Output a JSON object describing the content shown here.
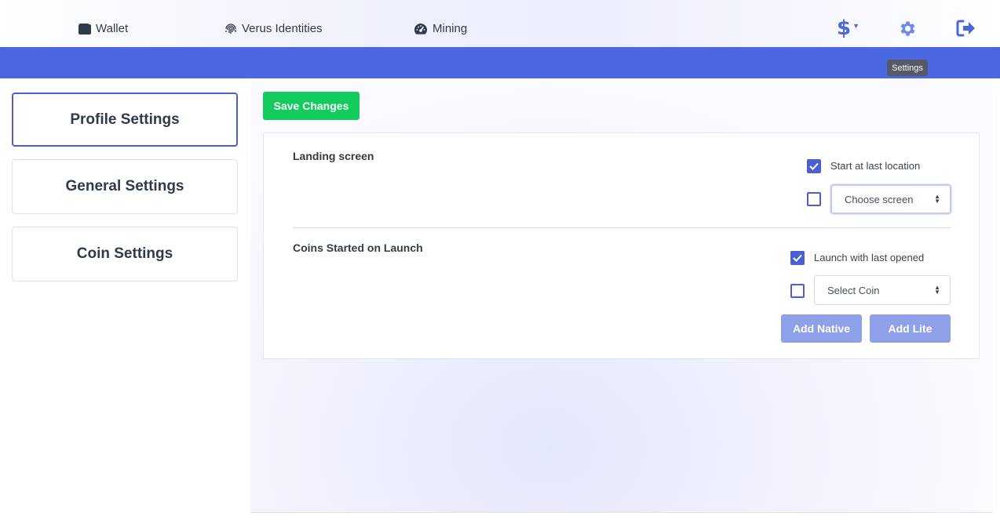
{
  "nav": {
    "wallet": "Wallet",
    "identities": "Verus Identities",
    "mining": "Mining",
    "currency_symbol": "$",
    "icons": {
      "wallet": "wallet-icon",
      "identities": "fingerprint-icon",
      "mining": "tachometer-icon",
      "currency": "dollar-icon",
      "settings": "gear-icon",
      "logout": "sign-out-icon"
    },
    "settings_tooltip": "Settings"
  },
  "sidebar": {
    "items": [
      {
        "label": "Profile Settings",
        "active": true
      },
      {
        "label": "General Settings",
        "active": false
      },
      {
        "label": "Coin Settings",
        "active": false
      }
    ]
  },
  "main": {
    "save_label": "Save Changes",
    "landing": {
      "label": "Landing screen",
      "start_last_label": "Start at last location",
      "start_last_checked": true,
      "choose_checked": false,
      "choose_placeholder": "Choose screen"
    },
    "coins": {
      "label": "Coins Started on Launch",
      "launch_last_label": "Launch with last opened",
      "launch_last_checked": true,
      "select_checked": false,
      "select_placeholder": "Select Coin",
      "add_native_label": "Add Native",
      "add_lite_label": "Add Lite"
    }
  },
  "colors": {
    "accent": "#4c68e0",
    "save_green": "#12cc5d",
    "disabled_button": "#8fa0ea",
    "checkbox": "#4c5fd2"
  }
}
